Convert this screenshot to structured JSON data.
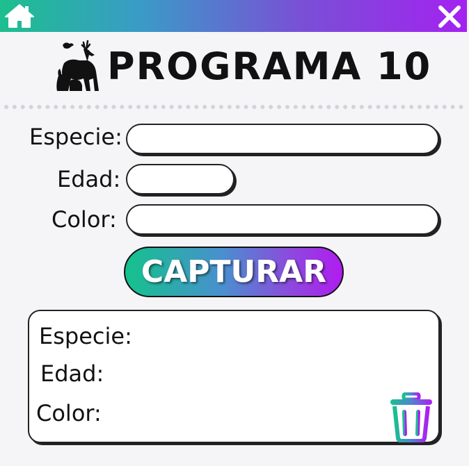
{
  "header": {
    "home_icon": "home-icon",
    "close_icon": "close-icon",
    "gradient": [
      "#1dbf8e",
      "#a322f0"
    ]
  },
  "title": {
    "logo_icon": "animals-silhouette-icon",
    "text": "PROGRAMA 10"
  },
  "form": {
    "especie_label": "Especie:",
    "especie_value": "",
    "edad_label": "Edad:",
    "edad_value": "",
    "color_label": "Color:",
    "color_value": ""
  },
  "capture_button": {
    "label": "CAPTURAR"
  },
  "results": {
    "especie_label": "Especie:",
    "edad_label": "Edad:",
    "color_label": "Color:",
    "delete_icon": "trash-icon"
  }
}
